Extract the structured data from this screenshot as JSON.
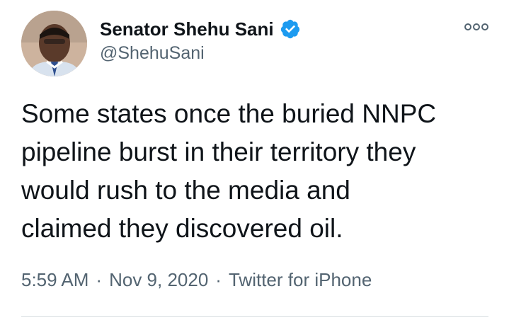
{
  "user": {
    "display_name": "Senator Shehu Sani",
    "handle": "@ShehuSani",
    "verified": true
  },
  "icons": {
    "verified": "verified-badge-icon",
    "more": "more-options-icon"
  },
  "tweet": {
    "text": "Some states once the buried NNPC\npipeline burst in their territory they\nwould rush to the media and\nclaimed they discovered oil.",
    "time": "5:59 AM",
    "date": "Nov 9, 2020",
    "source": "Twitter for iPhone",
    "separator": "·"
  },
  "colors": {
    "accent": "#1d9bf0",
    "text_primary": "#0f1419",
    "text_secondary": "#536471"
  }
}
